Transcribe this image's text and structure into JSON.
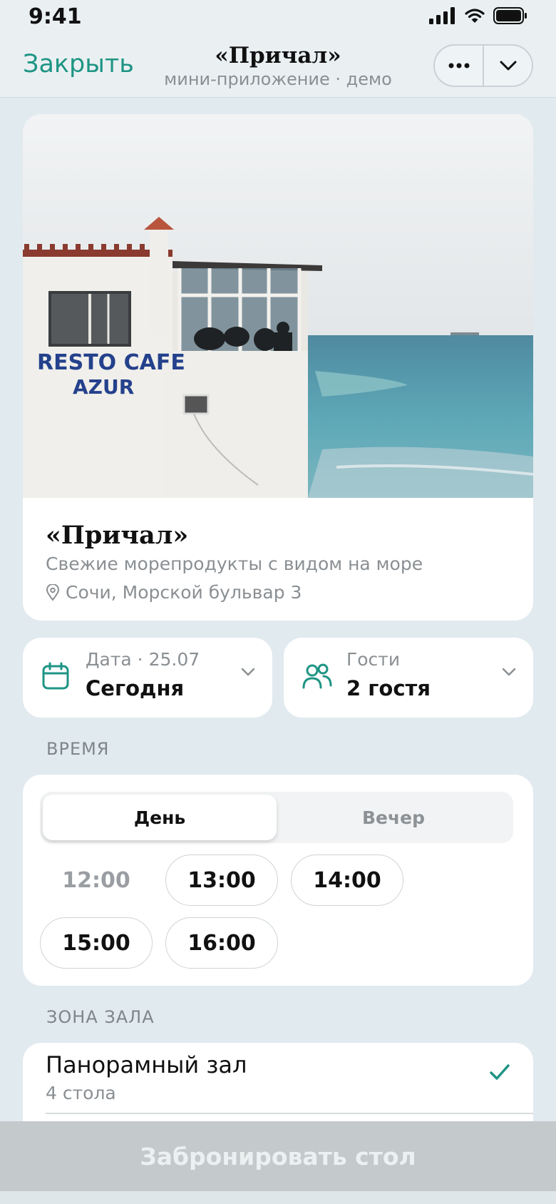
{
  "status": {
    "time": "9:41"
  },
  "nav": {
    "close_label": "Закрыть",
    "title": "«Причал»",
    "subtitle": "мини-приложение · демо"
  },
  "restaurant": {
    "name": "«Причал»",
    "description": "Свежие морепродукты с видом на море",
    "address": "Сочи, Морской бульвар 3",
    "photo_sign": [
      "RESTO CAFE",
      "AZUR"
    ]
  },
  "date_picker": {
    "label": "Дата · 25.07",
    "value": "Сегодня"
  },
  "guests_picker": {
    "label": "Гости",
    "value": "2 гостя"
  },
  "time_section": {
    "heading": "ВРЕМЯ",
    "tabs": [
      {
        "label": "День",
        "selected": true
      },
      {
        "label": "Вечер",
        "selected": false
      }
    ],
    "slots": [
      {
        "label": "12:00",
        "available": false
      },
      {
        "label": "13:00",
        "available": true
      },
      {
        "label": "14:00",
        "available": true
      },
      {
        "label": "15:00",
        "available": true
      },
      {
        "label": "16:00",
        "available": true
      }
    ]
  },
  "zone_section": {
    "heading": "ЗОНА ЗАЛА",
    "zones": [
      {
        "name": "Панорамный зал",
        "tables": "4 стола",
        "selected": true
      }
    ]
  },
  "book_button": {
    "label": "Забронировать стол",
    "enabled": false
  },
  "colors": {
    "accent": "#1e9484",
    "background": "#e1eaef",
    "disabled_button": "#c4c9cc"
  }
}
